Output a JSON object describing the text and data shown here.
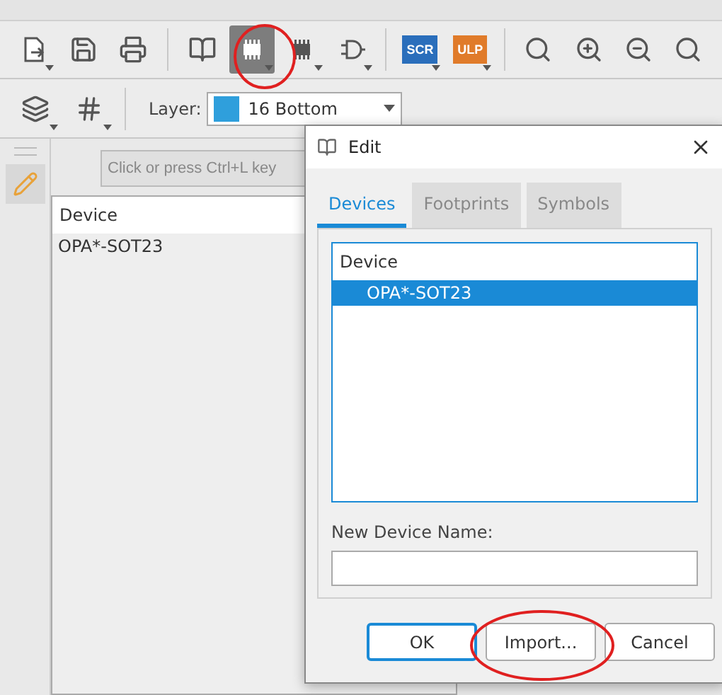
{
  "toolbar": {
    "tools": [
      {
        "kind": "icon",
        "selected": false,
        "dropdown": true
      },
      {
        "kind": "icon",
        "selected": false,
        "dropdown": false
      },
      {
        "kind": "icon",
        "selected": false,
        "dropdown": false
      },
      {
        "kind": "icon",
        "selected": false,
        "dropdown": false
      },
      {
        "kind": "icon",
        "selected": true,
        "dropdown": true
      },
      {
        "kind": "icon",
        "selected": false,
        "dropdown": true
      },
      {
        "kind": "icon",
        "selected": false,
        "dropdown": true
      },
      {
        "kind": "badge",
        "label": "SCR",
        "color": "#2a6ebb",
        "selected": false,
        "dropdown": true
      },
      {
        "kind": "badge",
        "label": "ULP",
        "color": "#e07b2a",
        "selected": false,
        "dropdown": true
      },
      {
        "kind": "icon",
        "selected": false,
        "dropdown": false
      },
      {
        "kind": "icon",
        "selected": false,
        "dropdown": false
      },
      {
        "kind": "icon",
        "selected": false,
        "dropdown": false
      },
      {
        "kind": "icon",
        "selected": false,
        "dropdown": false
      }
    ]
  },
  "layer_bar": {
    "label": "Layer:",
    "layer": {
      "name": "16 Bottom",
      "color": "#2f9fdc"
    }
  },
  "library_panel": {
    "search": {
      "placeholder": "Click or press Ctrl+L key"
    },
    "column": "Device",
    "rows": [
      {
        "name": "OPA*-SOT23",
        "selected": false
      }
    ]
  },
  "dialog": {
    "title": "Edit",
    "tabs": [
      {
        "label": "Devices",
        "selected": true
      },
      {
        "label": "Footprints",
        "selected": false
      },
      {
        "label": "Symbols",
        "selected": false
      }
    ],
    "list": {
      "column": "Device",
      "rows": [
        {
          "name": "OPA*-SOT23",
          "selected": true
        }
      ]
    },
    "field": {
      "label": "New Device Name:"
    },
    "buttons": [
      {
        "label": "OK",
        "default": true
      },
      {
        "label": "Import...",
        "default": false
      },
      {
        "label": "Cancel",
        "default": false
      }
    ]
  },
  "annotations": [
    {
      "kind": "circle"
    },
    {
      "kind": "circle"
    }
  ]
}
